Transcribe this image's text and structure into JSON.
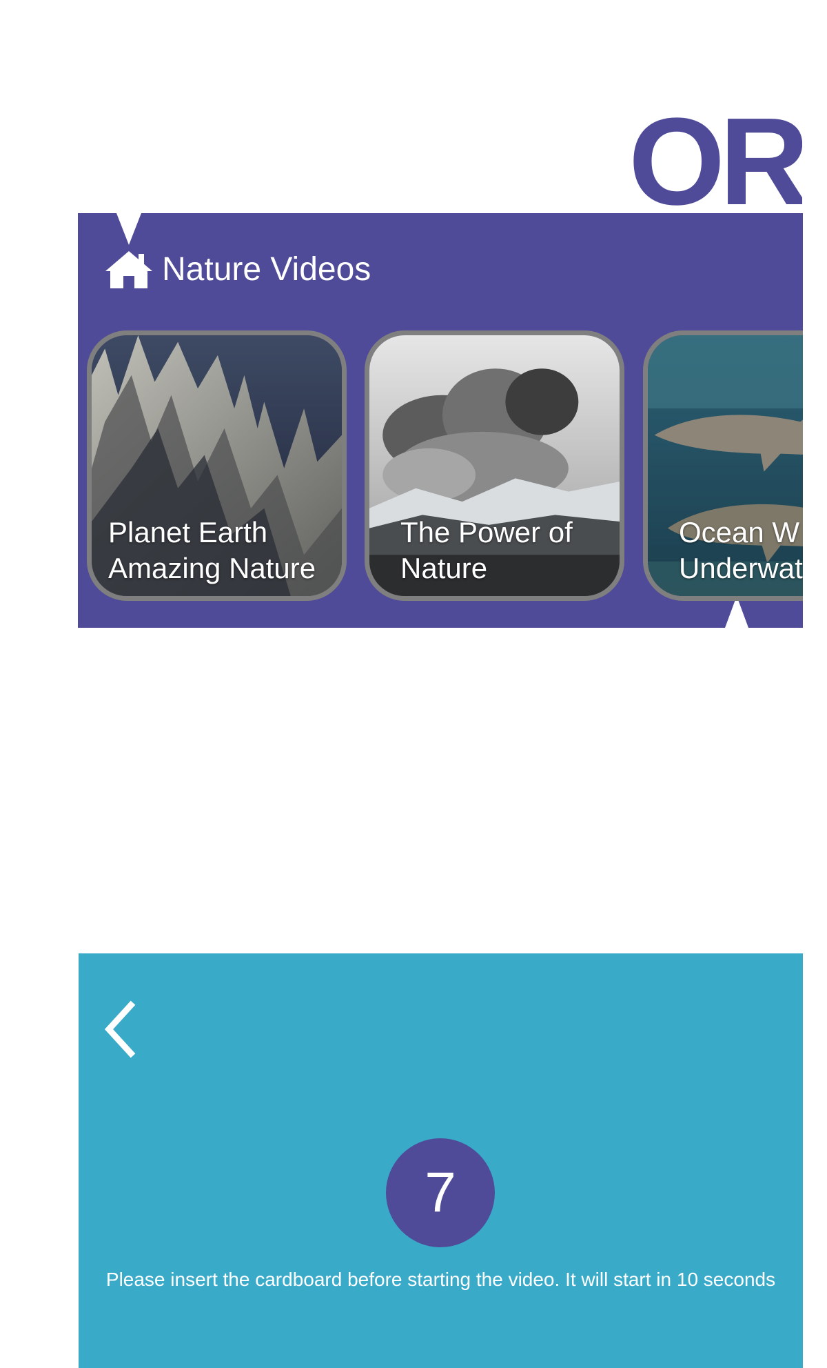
{
  "brand": {
    "title_fragment": "OR",
    "primary_color": "#4f4b99",
    "secondary_color": "#3aaac9",
    "card_border_color": "#7f7f7f"
  },
  "nature_panel": {
    "icon": "home-icon",
    "title": "Nature Videos",
    "cards": [
      {
        "title": "Planet Earth\nAmazing Nature",
        "image": "rocky-cliffs"
      },
      {
        "title": "The Power of\nNature",
        "image": "volcanic-ash-cloud"
      },
      {
        "title": "Ocean W\nUnderwat",
        "image": "sharks-underwater"
      }
    ]
  },
  "player_panel": {
    "back_icon": "chevron-left-icon",
    "countdown": "7",
    "message": "Please insert the cardboard before starting the video. It will start in 10 seconds"
  }
}
